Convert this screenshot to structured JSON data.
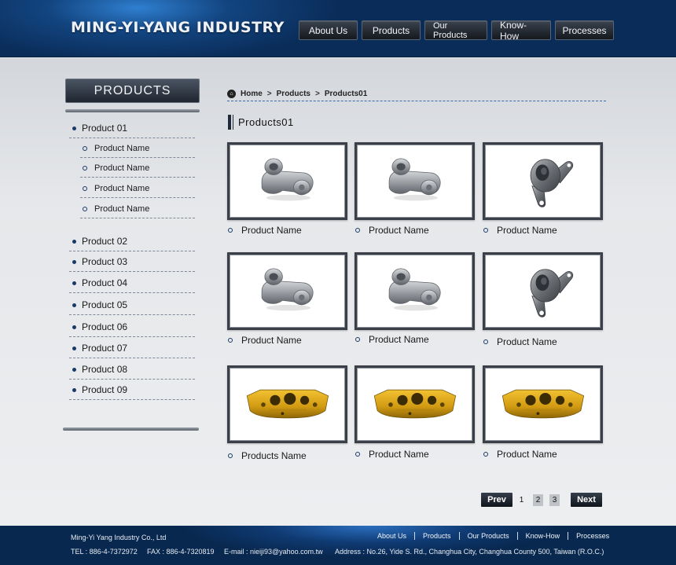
{
  "header": {
    "logo": "MING-YI-YANG  INDUSTRY",
    "nav": [
      "About  Us",
      "Products",
      "Our Products",
      "Know-How",
      "Processes"
    ]
  },
  "sidebar": {
    "title": "PRODUCTS",
    "categories": [
      {
        "label": "Product 01",
        "subs": [
          "Product  Name",
          "Product  Name",
          "Product  Name",
          "Product  Name"
        ]
      },
      {
        "label": "Product 02"
      },
      {
        "label": "Product 03"
      },
      {
        "label": "Product 04"
      },
      {
        "label": "Product 05"
      },
      {
        "label": "Product 06"
      },
      {
        "label": "Product 07"
      },
      {
        "label": "Product 08"
      },
      {
        "label": "Product 09"
      }
    ]
  },
  "breadcrumb": {
    "home": "Home",
    "sep": ">",
    "products": "Products",
    "current": "Products01"
  },
  "section_title": "Products01",
  "products": [
    {
      "label": "Product  Name",
      "image": "aluminum-casting-icon"
    },
    {
      "label": "Product  Name",
      "image": "aluminum-casting-icon"
    },
    {
      "label": "Product  Name",
      "image": "steel-bracket-icon"
    },
    {
      "label": "Product  Name",
      "image": "aluminum-casting-icon"
    },
    {
      "label": "Product  Name",
      "image": "aluminum-casting-icon"
    },
    {
      "label": "Product  Name",
      "image": "steel-bracket-icon"
    },
    {
      "label": "Products  Name",
      "image": "brake-caliper-icon"
    },
    {
      "label": "Product  Name",
      "image": "brake-caliper-icon"
    },
    {
      "label": "Product  Name",
      "image": "brake-caliper-icon"
    }
  ],
  "pager": {
    "prev": "Prev",
    "pages": [
      "1",
      "2",
      "3"
    ],
    "next": "Next"
  },
  "footer": {
    "company": "Ming-Yi Yang Industry Co., Ltd",
    "nav": [
      "About  Us",
      "Products",
      "Our Products",
      "Know-How",
      "Processes"
    ],
    "tel": "TEL : 886-4-7372972",
    "fax": "FAX : 886-4-7320819",
    "email": "E-mail : nieiji93@yahoo.com.tw",
    "address": "Address : No.26, Yide S. Rd., Changhua City, Changhua County 500, Taiwan (R.O.C.)"
  },
  "colors": {
    "header": "#0a2c58",
    "caliper": "#d9a416",
    "frame": "#3a3f48"
  }
}
